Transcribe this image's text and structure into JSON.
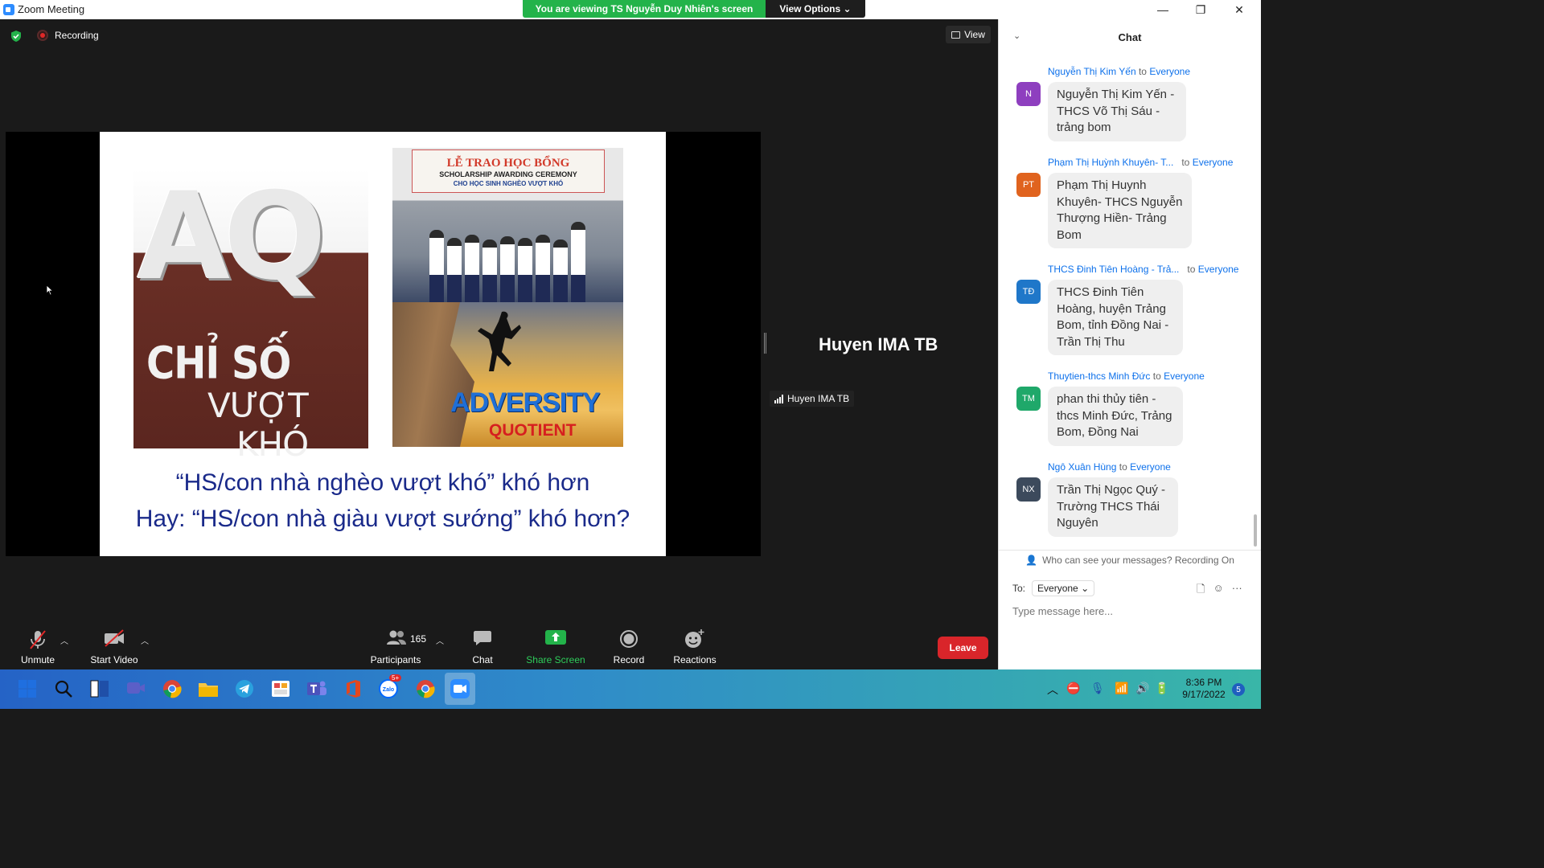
{
  "window": {
    "title": "Zoom Meeting",
    "banner": "You are viewing TS Nguyễn Duy Nhiên's screen",
    "view_options": "View Options"
  },
  "meeting": {
    "recording_label": "Recording",
    "view_label": "View",
    "speaker_name": "Huyen IMA TB",
    "speaker_tag": "Huyen IMA TB"
  },
  "slide": {
    "aq_letters": "AQ",
    "aq_line1": "CHỈ SỐ",
    "aq_line2": "VƯỢT",
    "aq_line3": "KHÓ",
    "banner_top": "",
    "banner_title": "LỄ TRAO HỌC BỔNG",
    "banner_sub": "SCHOLARSHIP AWARDING CEREMONY",
    "banner_sub2": "CHO HỌC SINH NGHÈO VƯỢT KHÓ",
    "adversity": "ADVERSITY",
    "quotient": "QUOTIENT",
    "line1": "“HS/con nhà nghèo vượt khó” khó hơn",
    "line2": "Hay: “HS/con nhà giàu vượt sướng” khó hơn?"
  },
  "toolbar": {
    "unmute": "Unmute",
    "start_video": "Start Video",
    "participants": "Participants",
    "participants_count": "165",
    "chat": "Chat",
    "share_screen": "Share Screen",
    "record": "Record",
    "reactions": "Reactions",
    "leave": "Leave"
  },
  "chat": {
    "title": "Chat",
    "messages": [
      {
        "sender": "Nguyễn Thị Kim Yến",
        "to": "to",
        "recipient": "Everyone",
        "avatar": "N",
        "avatar_color": "#8e3fbf",
        "text": "Nguyễn Thị Kim Yến - THCS Võ Thị Sáu - trảng bom"
      },
      {
        "sender": "Phạm Thị Huỳnh Khuyên- T...",
        "to": "to",
        "recipient": "Everyone",
        "avatar": "PT",
        "avatar_color": "#e0631e",
        "text": "Phạm Thị Huynh Khuyên- THCS Nguyễn Thượng Hiền- Trảng Bom"
      },
      {
        "sender": "THCS Đinh Tiên Hoàng - Trả...",
        "to": "to",
        "recipient": "Everyone",
        "avatar": "TĐ",
        "avatar_color": "#1f77c9",
        "text": "THCS Đinh Tiên Hoàng, huyện Trảng Bom, tỉnh Đồng Nai - Trần Thị Thu"
      },
      {
        "sender": "Thuytien-thcs Minh Đức",
        "to": "to",
        "recipient": "Everyone",
        "avatar": "TM",
        "avatar_color": "#1fa86a",
        "text": "phan thi thủy tiên - thcs Minh Đức, Trảng Bom, Đồng Nai"
      },
      {
        "sender": "Ngô Xuân Hùng",
        "to": "to",
        "recipient": "Everyone",
        "avatar": "NX",
        "avatar_color": "#3c4a5c",
        "text": "Trần Thị Ngọc Quý - Trường THCS Thái Nguyên"
      }
    ],
    "who_can_see": "Who can see your messages? Recording On",
    "to_label": "To:",
    "to_value": "Everyone",
    "placeholder": "Type message here..."
  },
  "taskbar": {
    "time": "8:36 PM",
    "date": "9/17/2022",
    "notifications": "5",
    "zalo_badge": "5+"
  }
}
